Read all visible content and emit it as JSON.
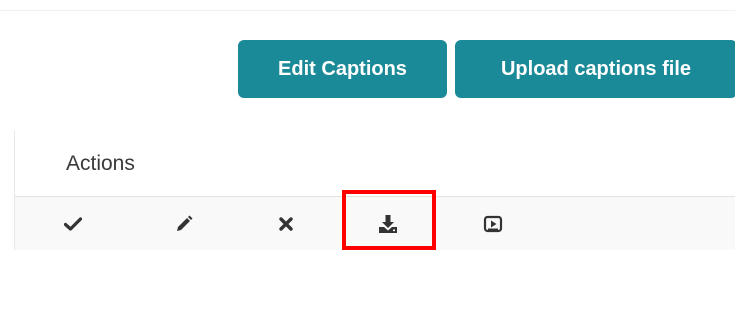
{
  "toolbar": {
    "edit_label": "Edit Captions",
    "upload_label": "Upload captions file"
  },
  "table": {
    "column_header": "Actions",
    "actions": [
      "approve-icon",
      "edit-icon",
      "delete-icon",
      "download-icon",
      "preview-icon"
    ]
  },
  "colors": {
    "button_bg": "#1b8a98",
    "highlight": "#ff0000",
    "icon": "#333333"
  }
}
